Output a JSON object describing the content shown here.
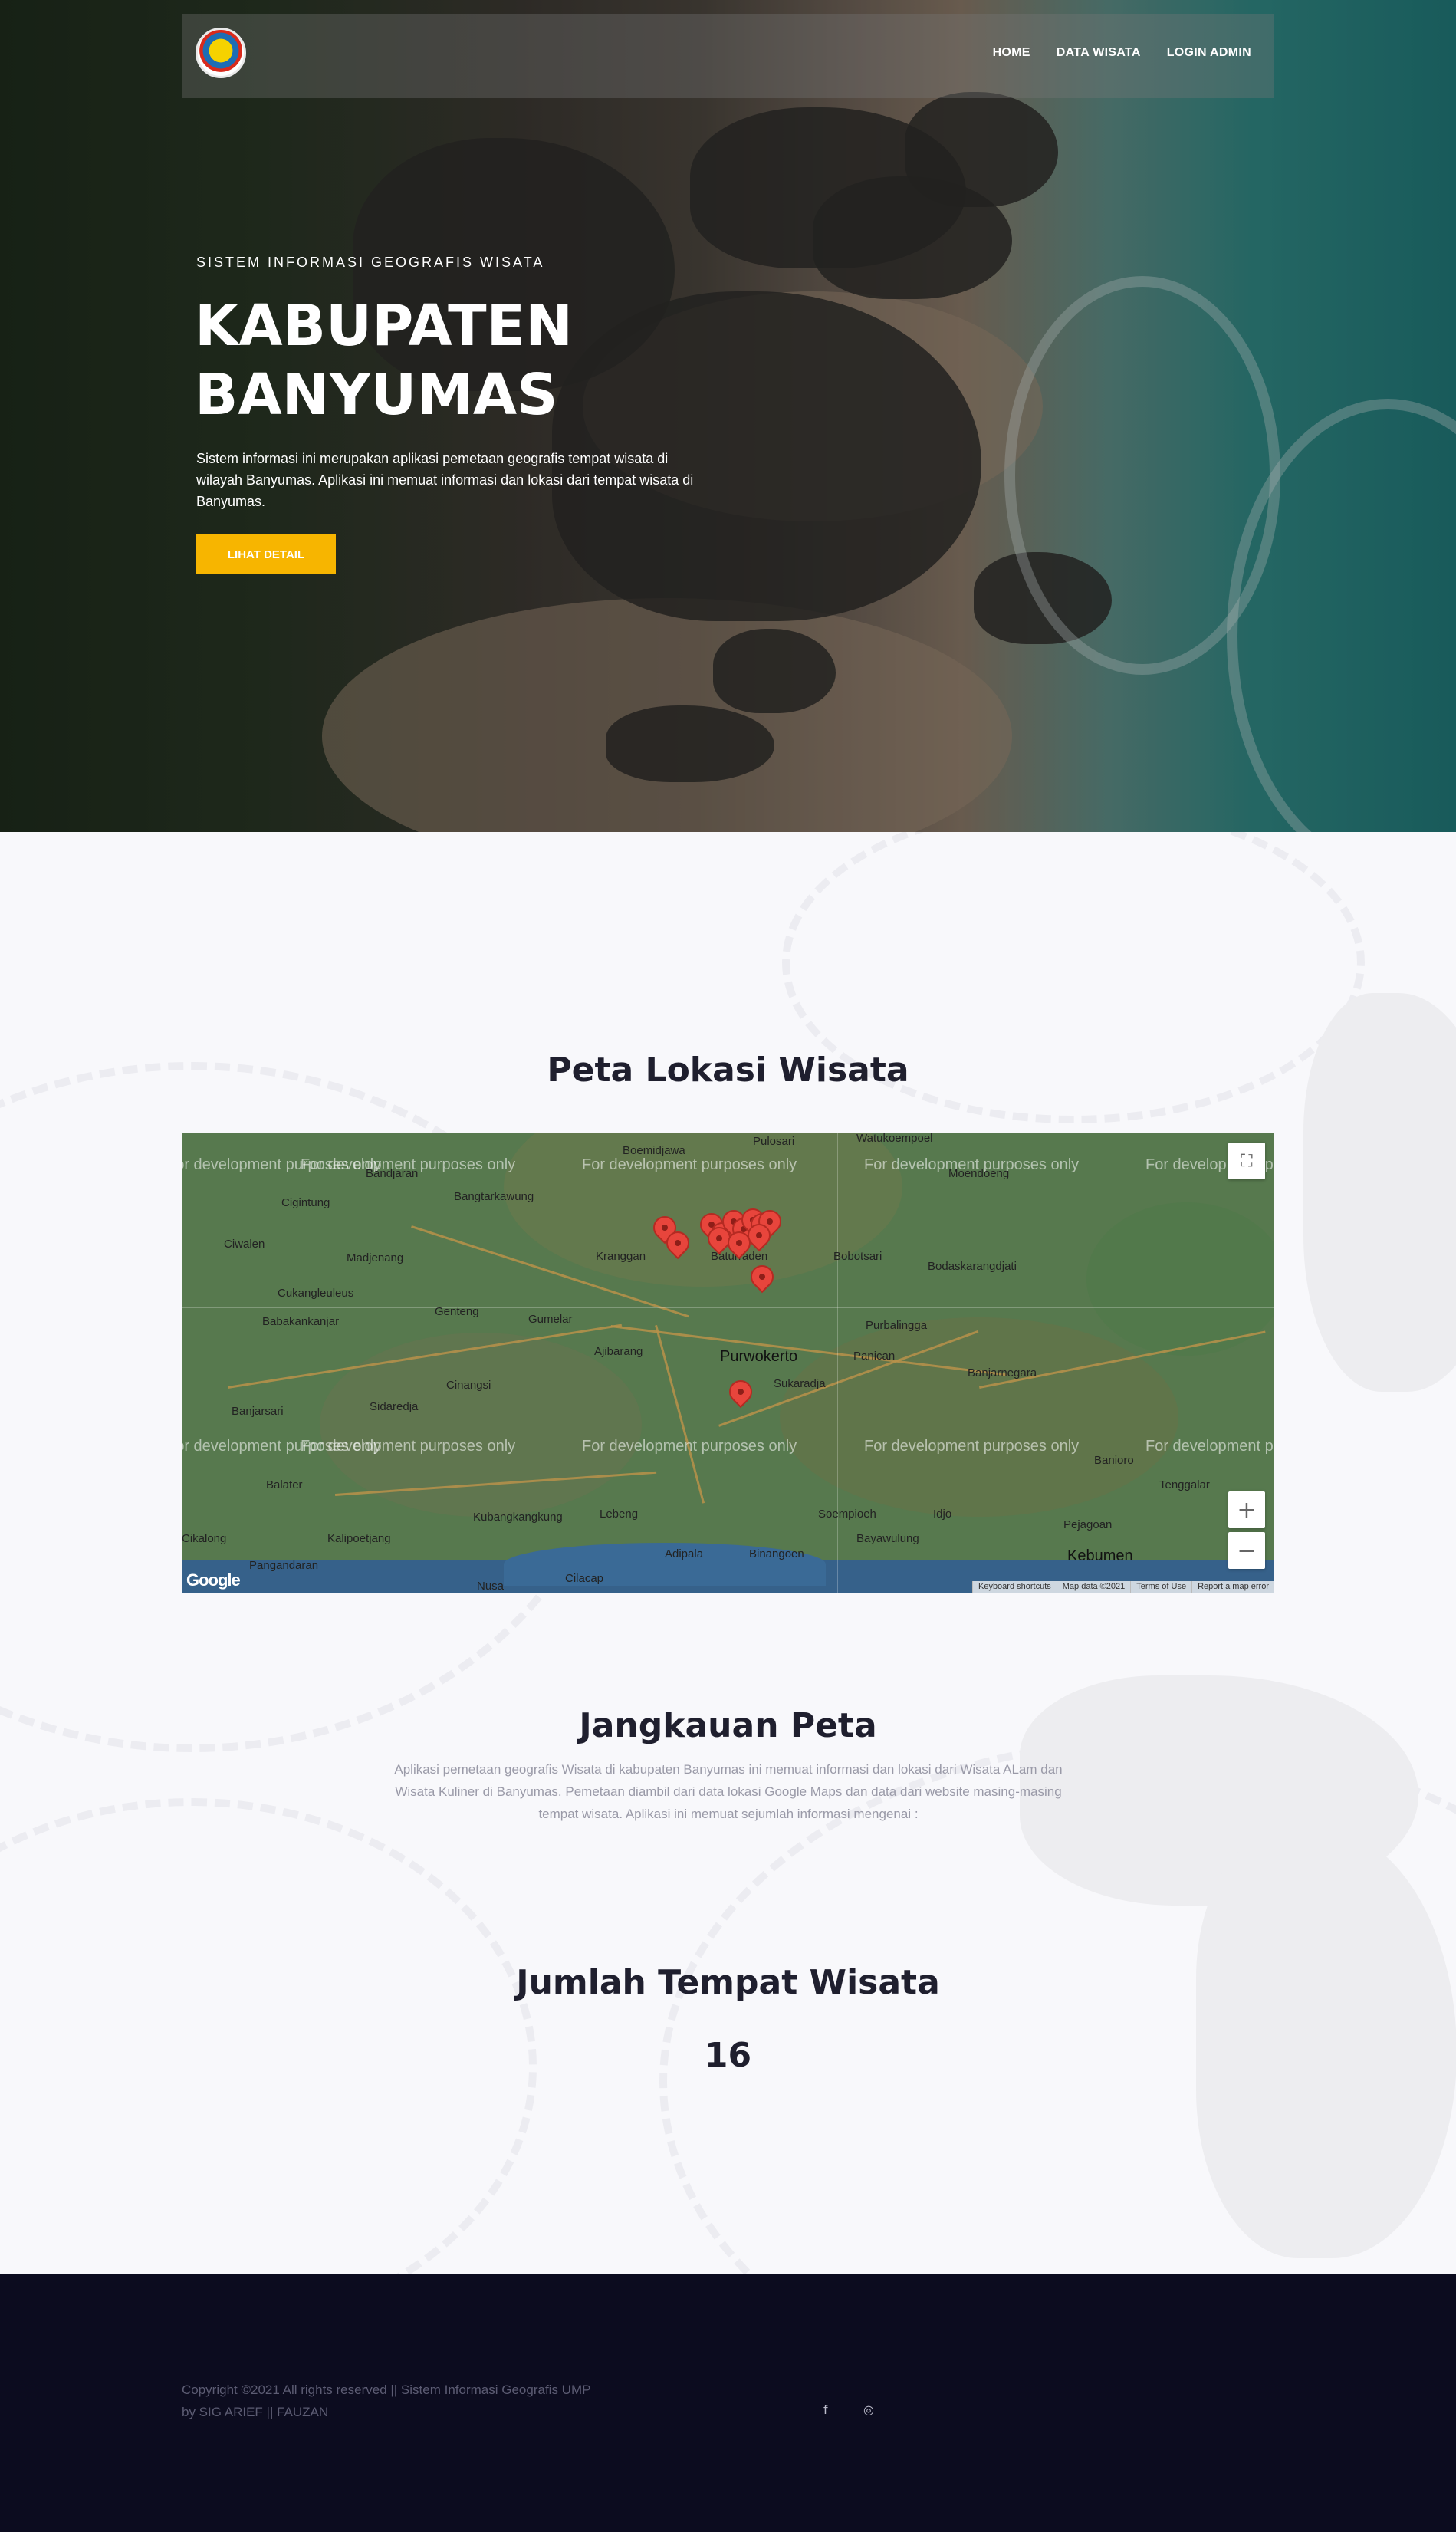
{
  "nav": {
    "logo_icon": "banyumas-regency-emblem",
    "items": [
      "HOME",
      "DATA WISATA",
      "LOGIN ADMIN"
    ]
  },
  "hero": {
    "subtitle": "SISTEM INFORMASI GEOGRAFIS WISATA",
    "title_line1": "KABUPATEN",
    "title_line2": "BANYUMAS",
    "description": "Sistem informasi ini merupakan aplikasi pemetaan geografis tempat wisata di wilayah Banyumas. Aplikasi ini memuat informasi dan lokasi dari tempat wisata di Banyumas.",
    "button_label": "LIHAT DETAIL",
    "button_color": "#f7b500"
  },
  "map_section": {
    "title": "Peta Lokasi Wisata",
    "map": {
      "watermark": "For development purposes only",
      "places": [
        "Pulosari",
        "Watukoempoel",
        "Boemidjawa",
        "Moendoeng",
        "Bandjaran",
        "Bangtarkawung",
        "Cigintung",
        "Ciwalen",
        "Madjenang",
        "Kranggan",
        "Baturraden",
        "Bobotsari",
        "Bodaskarangdjati",
        "Cukangleuleus",
        "Babakankanjar",
        "Genteng",
        "Gumelar",
        "Purbalingga",
        "Ajibarang",
        "Purwokerto",
        "Panican",
        "Cinangsi",
        "Sidaredja",
        "Sukaradja",
        "Banjarnegara",
        "Banjarsari",
        "Banioro",
        "Balater",
        "Tenggalar",
        "Kubangkangkung",
        "Lebeng",
        "Soempioeh",
        "Idjo",
        "Pejagoan",
        "Cikalong",
        "Kalipoetjang",
        "Bayawulung",
        "Kebumen",
        "Pangandaran",
        "Adipala",
        "Binangoen",
        "Nusa",
        "Cilacap"
      ],
      "marker_count_visible": 14,
      "marker_color": "#e8453c",
      "fullscreen_icon": "fullscreen-icon",
      "zoom_in_label": "+",
      "zoom_out_label": "−",
      "google_logo": "Google",
      "footer_links": [
        "Keyboard shortcuts",
        "Map data ©2021",
        "Terms of Use",
        "Report a map error"
      ]
    }
  },
  "coverage_section": {
    "title": "Jangkauan Peta",
    "description": "Aplikasi pemetaan geografis Wisata di kabupaten Banyumas ini memuat informasi dan lokasi dari Wisata ALam dan Wisata Kuliner di Banyumas. Pemetaan diambil dari data lokasi Google Maps dan data dari website masing-masing tempat wisata. Aplikasi ini memuat sejumlah informasi mengenai :"
  },
  "count_section": {
    "title": "Jumlah Tempat Wisata",
    "value": "16"
  },
  "footer": {
    "copyright_line1": "Copyright ©2021 All rights reserved || Sistem Informasi Geografis UMP",
    "copyright_line2": "by SIG ARIEF || FAUZAN",
    "social_icons": [
      {
        "name": "facebook-icon",
        "glyph": "f"
      },
      {
        "name": "instagram-icon",
        "glyph": "◎"
      }
    ]
  }
}
